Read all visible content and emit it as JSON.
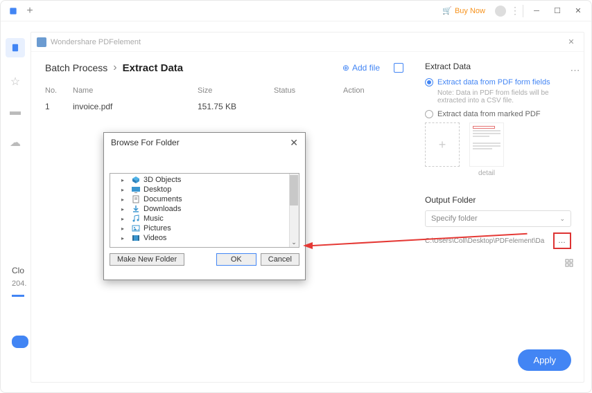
{
  "titlebar": {
    "buy_now": "Buy Now"
  },
  "modal": {
    "app_name": "Wondershare PDFelement",
    "breadcrumb1": "Batch Process",
    "breadcrumb2": "Extract Data",
    "add_file": "Add file",
    "table": {
      "headers": {
        "no": "No.",
        "name": "Name",
        "size": "Size",
        "status": "Status",
        "action": "Action"
      },
      "rows": [
        {
          "no": "1",
          "name": "invoice.pdf",
          "size": "151.75 KB",
          "status": "",
          "action": ""
        }
      ]
    }
  },
  "side": {
    "title": "Extract Data",
    "opt1": "Extract data from PDF form fields",
    "note": "Note: Data in PDF from fields will be extracted into a CSV file.",
    "opt2": "Extract data from marked PDF",
    "detail": "detail",
    "output_label": "Output Folder",
    "specify": "Specify folder",
    "path": "C:\\Users\\Coll\\Desktop\\PDFelement\\Da",
    "apply": "Apply"
  },
  "browser": {
    "title": "Browse For Folder",
    "items": [
      {
        "icon": "3d",
        "label": "3D Objects"
      },
      {
        "icon": "desktop",
        "label": "Desktop"
      },
      {
        "icon": "docs",
        "label": "Documents"
      },
      {
        "icon": "dl",
        "label": "Downloads"
      },
      {
        "icon": "music",
        "label": "Music"
      },
      {
        "icon": "pics",
        "label": "Pictures"
      },
      {
        "icon": "vids",
        "label": "Videos"
      }
    ],
    "new_folder": "Make New Folder",
    "ok": "OK",
    "cancel": "Cancel"
  },
  "left_panel": {
    "clo": "Clo",
    "num": "204."
  }
}
